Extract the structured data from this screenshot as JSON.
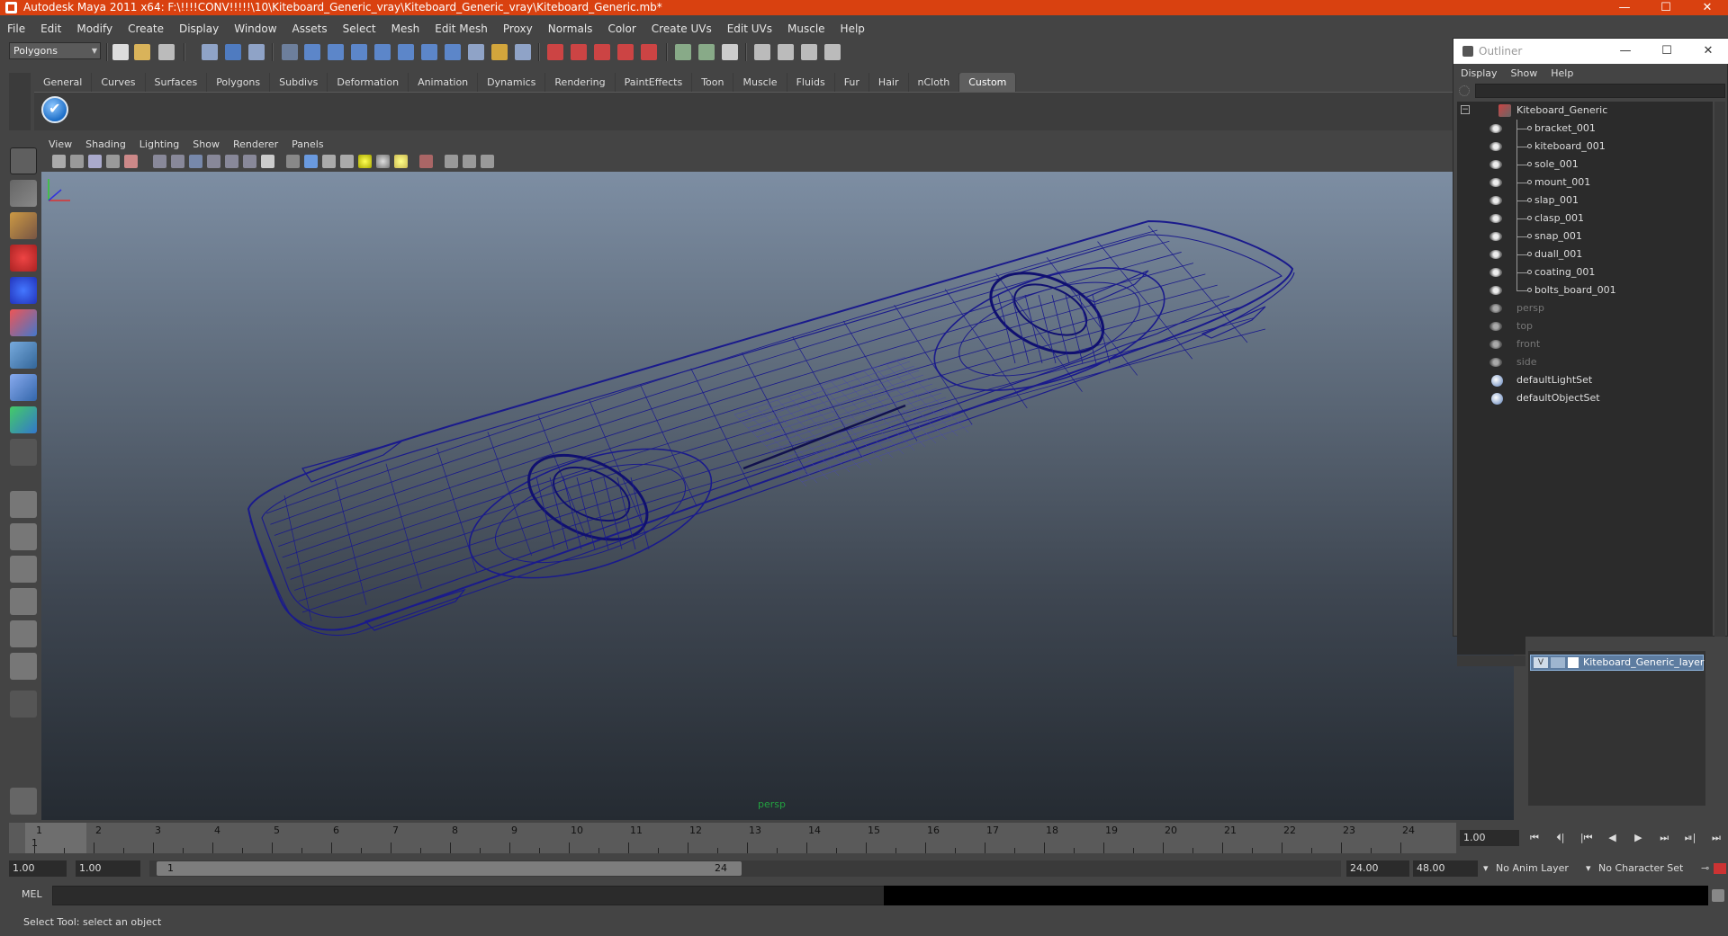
{
  "window": {
    "title": "Autodesk Maya 2011 x64: F:\\!!!!CONV!!!!!\\10\\Kiteboard_Generic_vray\\Kiteboard_Generic_vray\\Kiteboard_Generic.mb*",
    "minimize": "—",
    "maximize": "☐",
    "close": "✕"
  },
  "menubar": [
    "File",
    "Edit",
    "Modify",
    "Create",
    "Display",
    "Window",
    "Assets",
    "Select",
    "Mesh",
    "Edit Mesh",
    "Proxy",
    "Normals",
    "Color",
    "Create UVs",
    "Edit UVs",
    "Muscle",
    "Help"
  ],
  "statusline": {
    "mode": "Polygons"
  },
  "shelf": {
    "tabs": [
      "General",
      "Curves",
      "Surfaces",
      "Polygons",
      "Subdivs",
      "Deformation",
      "Animation",
      "Dynamics",
      "Rendering",
      "PaintEffects",
      "Toon",
      "Muscle",
      "Fluids",
      "Fur",
      "Hair",
      "nCloth",
      "Custom"
    ],
    "active_tab": "Custom"
  },
  "panel": {
    "menus": [
      "View",
      "Shading",
      "Lighting",
      "Show",
      "Renderer",
      "Panels"
    ],
    "camera_label": "persp",
    "wire_color": "#1a1a8c"
  },
  "outliner": {
    "title": "Outliner",
    "menus": [
      "Display",
      "Show",
      "Help"
    ],
    "root": "Kiteboard_Generic",
    "children": [
      "bracket_001",
      "kiteboard_001",
      "sole_001",
      "mount_001",
      "slap_001",
      "clasp_001",
      "snap_001",
      "duall_001",
      "coating_001",
      "bolts_board_001"
    ],
    "cameras": [
      "persp",
      "top",
      "front",
      "side"
    ],
    "sets": [
      "defaultLightSet",
      "defaultObjectSet"
    ]
  },
  "layer_editor": {
    "layer_name": "Kiteboard_Generic_layer",
    "visible_flag": "V"
  },
  "timeslider": {
    "ticks": [
      "1",
      "2",
      "3",
      "4",
      "5",
      "6",
      "7",
      "8",
      "9",
      "10",
      "11",
      "12",
      "13",
      "14",
      "15",
      "16",
      "17",
      "18",
      "19",
      "20",
      "21",
      "22",
      "23",
      "24"
    ],
    "current_frame": "1",
    "current_frame_field": "1.00"
  },
  "playback": [
    "⏮",
    "⏴|",
    "|⏮",
    "◀",
    "▶",
    "⏭",
    "⏯|",
    "⏭"
  ],
  "range": {
    "start": "1.00",
    "anim_start": "1.00",
    "handle_start": "1",
    "handle_end": "24",
    "end": "24.00",
    "anim_end": "48.00",
    "anim_layer": "No Anim Layer",
    "character_set": "No Character Set"
  },
  "commandline": {
    "label": "MEL"
  },
  "helpline": {
    "text": "Select Tool: select an object"
  }
}
